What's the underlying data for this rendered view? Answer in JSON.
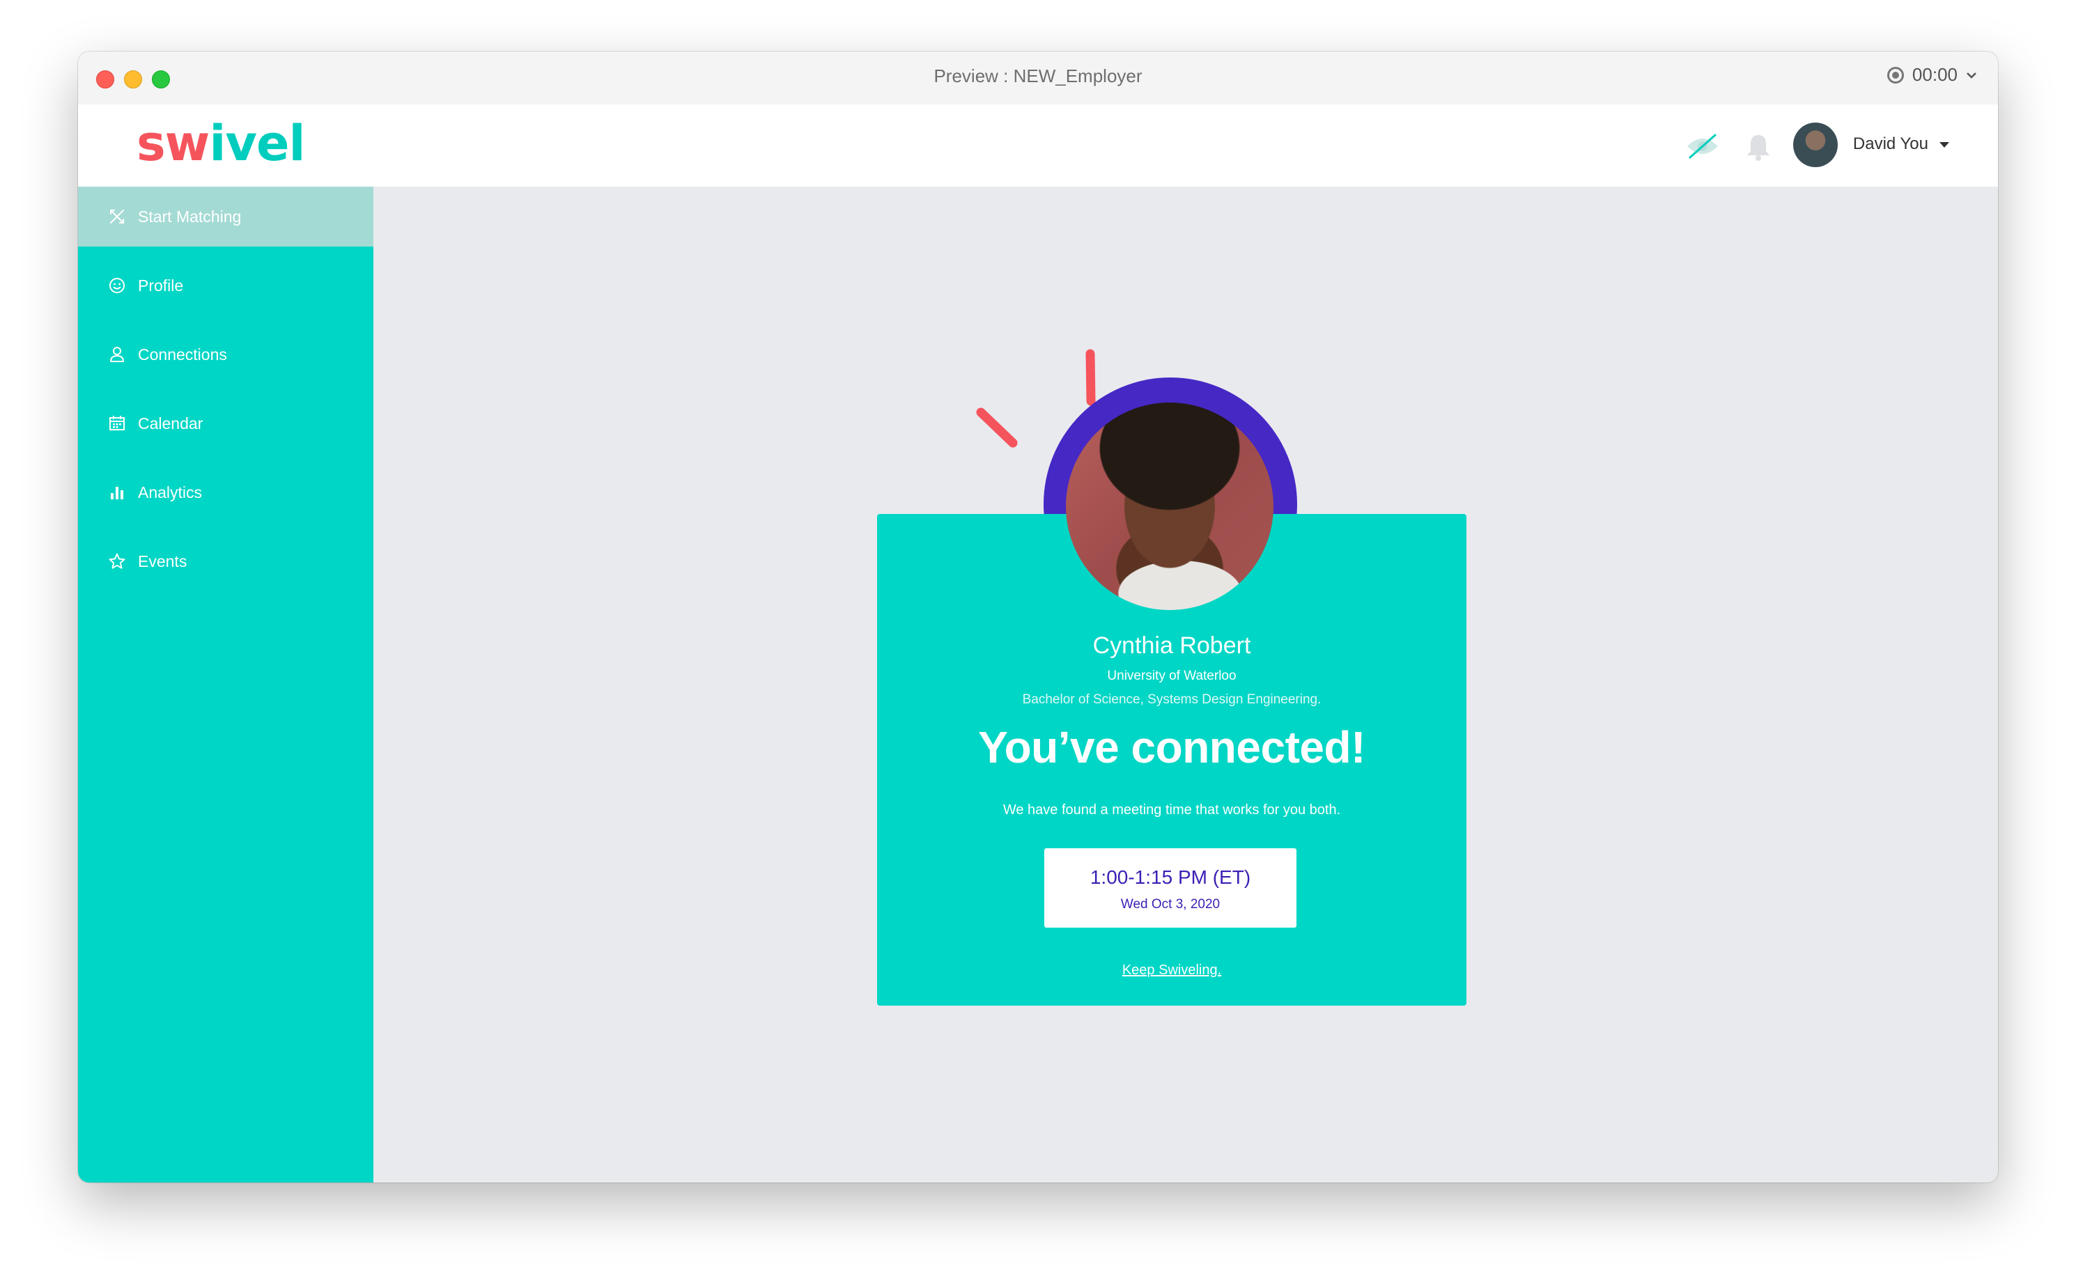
{
  "window": {
    "title": "Preview : NEW_Employer",
    "timer": "00:00"
  },
  "brand": {
    "logo_part1": "sw",
    "logo_i": "i",
    "logo_part2": "vel"
  },
  "sidebar": {
    "items": [
      {
        "label": "Start Matching",
        "icon": "matching-icon",
        "active": true
      },
      {
        "label": "Profile",
        "icon": "smiley-icon",
        "active": false
      },
      {
        "label": "Connections",
        "icon": "person-icon",
        "active": false
      },
      {
        "label": "Calendar",
        "icon": "calendar-icon",
        "active": false
      },
      {
        "label": "Analytics",
        "icon": "bar-chart-icon",
        "active": false
      },
      {
        "label": "Events",
        "icon": "star-icon",
        "active": false
      }
    ]
  },
  "header": {
    "user_name": "David You"
  },
  "match": {
    "name": "Cynthia Robert",
    "school": "University of Waterloo",
    "degree": "Bachelor of Science, Systems Design Engineering.",
    "headline": "You’ve connected!",
    "message": "We have found a meeting time that works for you both.",
    "time": "1:00-1:15 PM (ET)",
    "date": "Wed Oct 3, 2020",
    "link": "Keep Swiveling."
  },
  "colors": {
    "teal": "#00d6c5",
    "active_nav": "#a4dad4",
    "coral": "#f5545c",
    "purple": "#4628c5",
    "background": "#e9eaee"
  }
}
